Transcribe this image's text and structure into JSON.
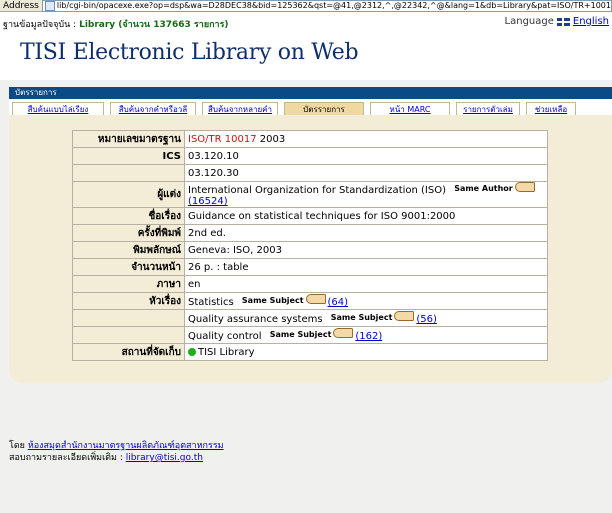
{
  "browser": {
    "address_label": "Address",
    "url": "lib/cgi-bin/opacexe.exe?op=dsp&wa=D28DEC38&bid=125362&qst=@41,@2312,^,@22342,^@&lang=1&db=Library&pat=ISO/TR+10017&cat=q"
  },
  "header": {
    "db_prefix": "ฐานข้อมูลปัจจุบัน :",
    "db_name": "Library (จำนวน 137663 รายการ)",
    "language_label": "Language",
    "language_link": "English",
    "site_title": "TISI Electronic Library on Web"
  },
  "bluebar": {
    "label": "บัตรรายการ"
  },
  "tabs": [
    {
      "label": "สืบค้นแบบไล่เรียง",
      "active": false
    },
    {
      "label": "สืบค้นจากคำหรือวลี",
      "active": false
    },
    {
      "label": "สืบค้นจากหลายคำ",
      "active": false
    },
    {
      "label": "บัตรรายการ",
      "active": true
    },
    {
      "label": "หน้า MARC",
      "active": false
    },
    {
      "label": "รายการตัวเล่ม",
      "active": false
    },
    {
      "label": "ช่วยเหลือ",
      "active": false
    }
  ],
  "record": {
    "std_label": "หมายเลขมาตรฐาน",
    "std_iso": "ISO",
    "std_sep": "/",
    "std_tr": "TR 10017",
    "std_year": "2003",
    "ics_label": "ICS",
    "ics_1": "03.120.10",
    "ics_2": "03.120.30",
    "author_label": "ผู้แต่ง",
    "author": "International Organization for Standardization (ISO)",
    "same_author": "Same Author",
    "author_count": "(16524)",
    "title_label": "ชื่อเรื่อง",
    "title": "Guidance on statistical techniques for ISO 9001:2000",
    "edition_label": "ครั้งที่พิมพ์",
    "edition": "2nd ed.",
    "publication_label": "พิมพลักษณ์",
    "publication": "Geneva: ISO, 2003",
    "pages_label": "จำนวนหน้า",
    "pages": "26 p. : table",
    "language_label": "ภาษา",
    "language": "en",
    "subject_label": "หัวเรื่อง",
    "subjects": [
      {
        "text": "Statistics",
        "same": "Same Subject",
        "count": "(64)"
      },
      {
        "text": "Quality assurance systems",
        "same": "Same Subject",
        "count": "(56)"
      },
      {
        "text": "Quality control",
        "same": "Same Subject",
        "count": "(162)"
      }
    ],
    "location_label": "สถานที่จัดเก็บ",
    "location": "TISI Library"
  },
  "footer": {
    "by_prefix": "โดย",
    "by_link": "ห้องสมุดสำนักงานมาตรฐานผลิตภัณฑ์อุตสาหกรรม",
    "contact_prefix": "สอบถามรายละเอียดเพิ่มเติม :",
    "email": "library@tisi.go.th"
  },
  "colors": {
    "brand_blue": "#0c4a86",
    "title_navy": "#0f2f6c",
    "panel_beige": "#f3ecd6",
    "tab_active": "#f0d9a0",
    "link": "#0000cc",
    "std_red": "#c81414"
  },
  "icons": [
    "page-icon",
    "uk-flag-icon",
    "pointing-hand-icon",
    "green-dot-icon"
  ]
}
